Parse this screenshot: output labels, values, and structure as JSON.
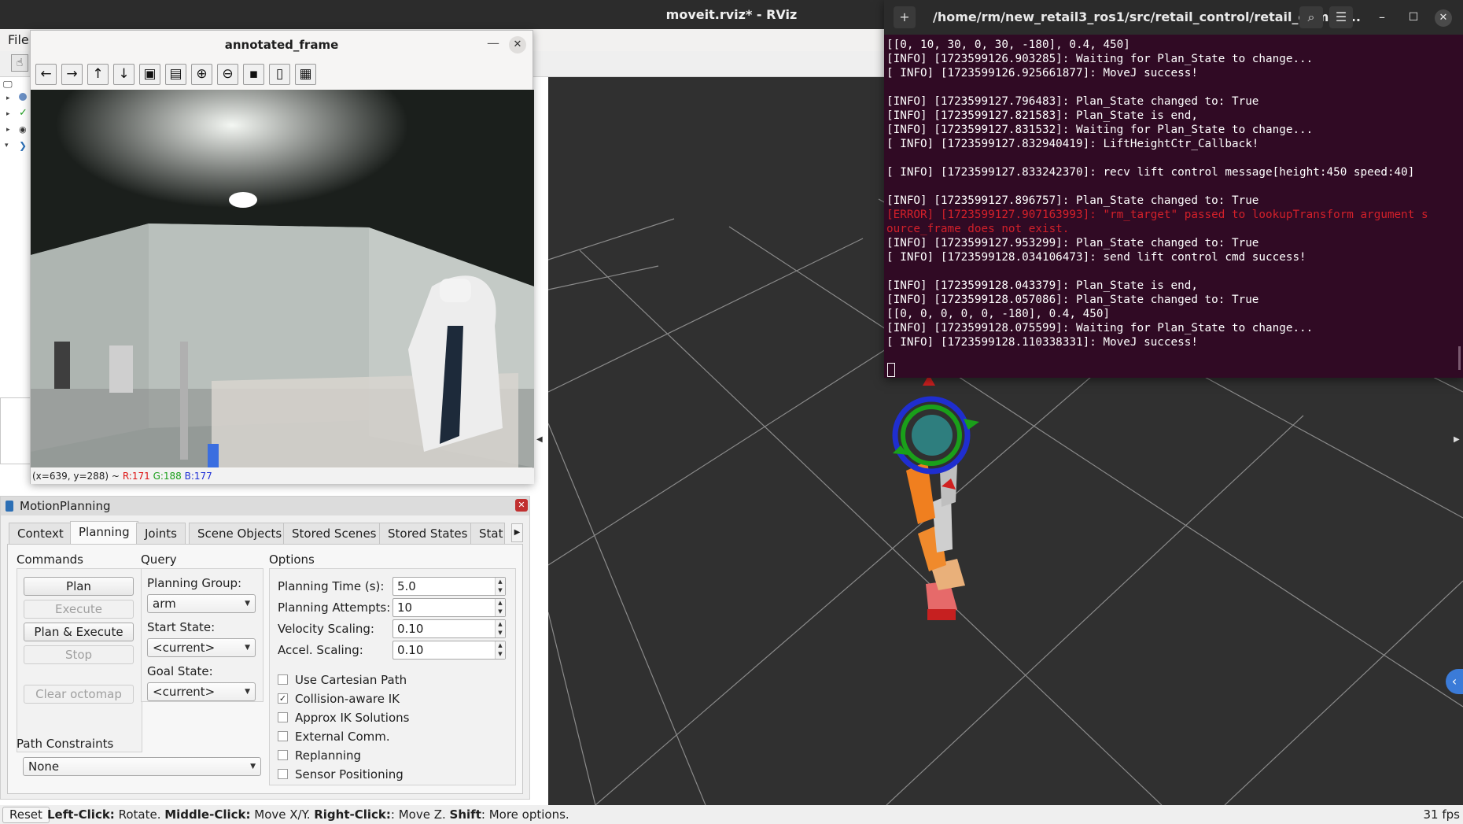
{
  "window": {
    "title": "moveit.rviz* - RViz"
  },
  "menu": {
    "file": "File"
  },
  "annotated_frame": {
    "title": "annotated_frame",
    "pixel_info": {
      "coords": "(x=639, y=288) ~",
      "r": "R:171",
      "g": "G:188",
      "b": "B:177"
    },
    "toolbar_icons": [
      "arrow-left-icon",
      "arrow-right-icon",
      "arrow-up-icon",
      "arrow-down-icon",
      "zoom-fit-icon",
      "zoom-original-icon",
      "zoom-in-icon",
      "zoom-out-icon",
      "save-icon",
      "copy-icon",
      "settings-icon"
    ]
  },
  "motion_planning": {
    "title": "MotionPlanning",
    "tabs": [
      "Context",
      "Planning",
      "Joints",
      "Scene Objects",
      "Stored Scenes",
      "Stored States",
      "Stat"
    ],
    "active_tab": "Planning",
    "commands": {
      "title": "Commands",
      "plan": "Plan",
      "execute": "Execute",
      "plan_execute": "Plan & Execute",
      "stop": "Stop",
      "clear_octomap": "Clear octomap"
    },
    "query": {
      "title": "Query",
      "planning_group_label": "Planning Group:",
      "planning_group_value": "arm",
      "start_state_label": "Start State:",
      "start_state_value": "<current>",
      "goal_state_label": "Goal State:",
      "goal_state_value": "<current>"
    },
    "options": {
      "title": "Options",
      "planning_time_label": "Planning Time (s):",
      "planning_time": "5.0",
      "planning_attempts_label": "Planning Attempts:",
      "planning_attempts": "10",
      "velocity_scaling_label": "Velocity Scaling:",
      "velocity_scaling": "0.10",
      "accel_scaling_label": "Accel. Scaling:",
      "accel_scaling": "0.10",
      "use_cartesian": "Use Cartesian Path",
      "collision_aware": "Collision-aware IK",
      "approx_ik": "Approx IK Solutions",
      "external_comm": "External Comm.",
      "replanning": "Replanning",
      "sensor_positioning": "Sensor Positioning",
      "checked": [
        false,
        true,
        false,
        false,
        false,
        false
      ]
    },
    "path_constraints": {
      "label": "Path Constraints",
      "value": "None"
    }
  },
  "status_bar": {
    "reset": "Reset",
    "hint_left_key": "Left-Click:",
    "hint_left_val": " Rotate. ",
    "hint_middle_key": "Middle-Click:",
    "hint_middle_val": " Move X/Y. ",
    "hint_right_key": "Right-Click:",
    "hint_right_val": ": Move Z. ",
    "hint_shift_key": "Shift",
    "hint_shift_val": ": More options.",
    "fps": "31 fps"
  },
  "terminal": {
    "title": "/home/rm/new_retail3_ros1/src/retail_control/retail_demo/l...",
    "lines": [
      "[[0, 10, 30, 0, 30, -180], 0.4, 450]",
      "[INFO] [1723599126.903285]: Waiting for Plan_State to change...",
      "[ INFO] [1723599126.925661877]: MoveJ success!",
      "",
      "[INFO] [1723599127.796483]: Plan_State changed to: True",
      "[INFO] [1723599127.821583]: Plan_State is end,",
      "[INFO] [1723599127.831532]: Waiting for Plan_State to change...",
      "[ INFO] [1723599127.832940419]: LiftHeightCtr_Callback!",
      "",
      "[ INFO] [1723599127.833242370]: recv lift control message[height:450 speed:40]",
      "",
      "[INFO] [1723599127.896757]: Plan_State changed to: True",
      "[ERROR] [1723599127.907163993]: \"rm_target\" passed to lookupTransform argument s",
      "ource_frame does not exist.",
      "[INFO] [1723599127.953299]: Plan_State changed to: True",
      "[ INFO] [1723599128.034106473]: send lift control cmd success!",
      "",
      "[INFO] [1723599128.043379]: Plan_State is end,",
      "[INFO] [1723599128.057086]: Plan_State changed to: True",
      "[[0, 0, 0, 0, 0, -180], 0.4, 450]",
      "[INFO] [1723599128.075599]: Waiting for Plan_State to change...",
      "[ INFO] [1723599128.110338331]: MoveJ success!"
    ],
    "error_line_indices": [
      12,
      13
    ]
  }
}
